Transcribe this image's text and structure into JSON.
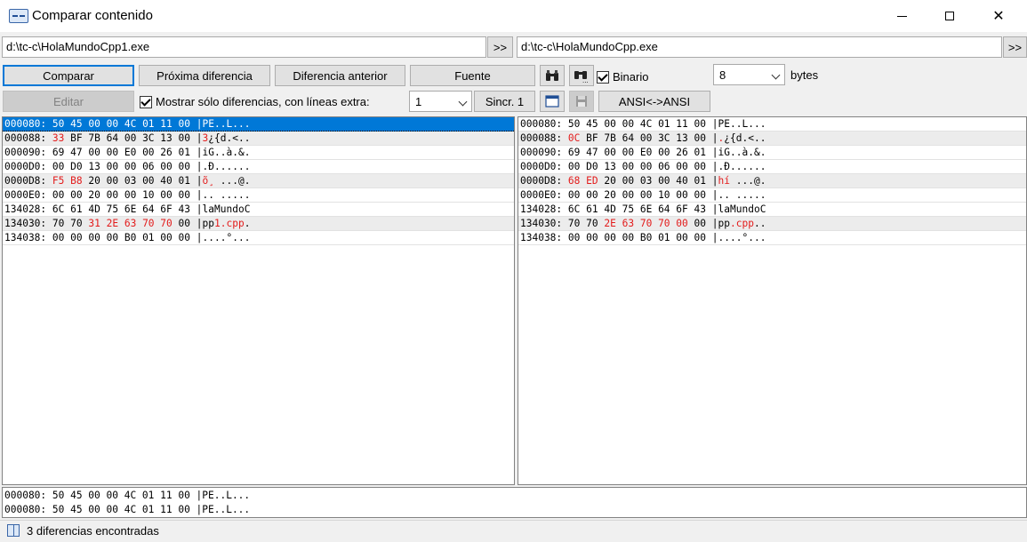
{
  "window": {
    "title": "Comparar contenido",
    "controls": {
      "minimize": "minimize",
      "maximize": "maximize",
      "close": "✕"
    }
  },
  "files": {
    "left_path": "d:\\tc-c\\HolaMundoCpp1.exe",
    "right_path": "d:\\tc-c\\HolaMundoCpp.exe",
    "browse_label": ">>"
  },
  "toolbar": {
    "compare": "Comparar",
    "next_diff": "Próxima diferencia",
    "prev_diff": "Diferencia anterior",
    "font": "Fuente",
    "find_icon": "binoculars-icon",
    "find_next_icon": "binoculars-next-icon",
    "binary_label": "Binario",
    "binary_checked": true,
    "bytes_value": "8",
    "bytes_label": "bytes",
    "edit": "Editar",
    "show_diff_only_label": "Mostrar sólo diferencias, con líneas extra:",
    "show_diff_only_checked": true,
    "extra_lines_value": "1",
    "sync": "Sincr. 1",
    "save_icon": "save-icon",
    "window_icon": "window-icon",
    "ansi": "ANSI<->ANSI"
  },
  "left_lines": [
    {
      "addr": "000080:",
      "bytes": [
        "50",
        "45",
        "00",
        "00",
        "4C",
        "01",
        "11",
        "00"
      ],
      "ascii": "PE..L...",
      "diff_bytes": [],
      "selected": true
    },
    {
      "addr": "000088:",
      "bytes": [
        "33",
        "BF",
        "7B",
        "64",
        "00",
        "3C",
        "13",
        "00"
      ],
      "ascii": "3¿{d.<..",
      "diff_bytes": [
        0
      ],
      "diff_ascii": [
        0
      ],
      "diffrow": true
    },
    {
      "addr": "000090:",
      "bytes": [
        "69",
        "47",
        "00",
        "00",
        "E0",
        "00",
        "26",
        "01"
      ],
      "ascii": "iG..à.&.",
      "diff_bytes": []
    },
    {
      "addr": "0000D0:",
      "bytes": [
        "00",
        "D0",
        "13",
        "00",
        "00",
        "06",
        "00",
        "00"
      ],
      "ascii": ".Ð......",
      "diff_bytes": []
    },
    {
      "addr": "0000D8:",
      "bytes": [
        "F5",
        "B8",
        "20",
        "00",
        "03",
        "00",
        "40",
        "01"
      ],
      "ascii": "õ¸ ...@.",
      "diff_bytes": [
        0,
        1
      ],
      "diff_ascii": [
        0,
        1
      ],
      "diffrow": true
    },
    {
      "addr": "0000E0:",
      "bytes": [
        "00",
        "00",
        "20",
        "00",
        "00",
        "10",
        "00",
        "00"
      ],
      "ascii": ".. .....",
      "diff_bytes": []
    },
    {
      "addr": "134028:",
      "bytes": [
        "6C",
        "61",
        "4D",
        "75",
        "6E",
        "64",
        "6F",
        "43"
      ],
      "ascii": "laMundoC",
      "diff_bytes": []
    },
    {
      "addr": "134030:",
      "bytes": [
        "70",
        "70",
        "31",
        "2E",
        "63",
        "70",
        "70",
        "00"
      ],
      "ascii": "pp1.cpp.",
      "diff_bytes": [
        2,
        3,
        4,
        5,
        6
      ],
      "diff_ascii": [
        2,
        3,
        4,
        5,
        6
      ],
      "diffrow": true
    },
    {
      "addr": "134038:",
      "bytes": [
        "00",
        "00",
        "00",
        "00",
        "B0",
        "01",
        "00",
        "00"
      ],
      "ascii": "....°...",
      "diff_bytes": []
    }
  ],
  "right_lines": [
    {
      "addr": "000080:",
      "bytes": [
        "50",
        "45",
        "00",
        "00",
        "4C",
        "01",
        "11",
        "00"
      ],
      "ascii": "PE..L...",
      "diff_bytes": []
    },
    {
      "addr": "000088:",
      "bytes": [
        "0C",
        "BF",
        "7B",
        "64",
        "00",
        "3C",
        "13",
        "00"
      ],
      "ascii": ".¿{d.<..",
      "diff_bytes": [
        0
      ],
      "diff_ascii": [
        0
      ],
      "diffrow": true
    },
    {
      "addr": "000090:",
      "bytes": [
        "69",
        "47",
        "00",
        "00",
        "E0",
        "00",
        "26",
        "01"
      ],
      "ascii": "iG..à.&.",
      "diff_bytes": []
    },
    {
      "addr": "0000D0:",
      "bytes": [
        "00",
        "D0",
        "13",
        "00",
        "00",
        "06",
        "00",
        "00"
      ],
      "ascii": ".Ð......",
      "diff_bytes": []
    },
    {
      "addr": "0000D8:",
      "bytes": [
        "68",
        "ED",
        "20",
        "00",
        "03",
        "00",
        "40",
        "01"
      ],
      "ascii": "hí ...@.",
      "diff_bytes": [
        0,
        1
      ],
      "diff_ascii": [
        0,
        1
      ],
      "diffrow": true
    },
    {
      "addr": "0000E0:",
      "bytes": [
        "00",
        "00",
        "20",
        "00",
        "00",
        "10",
        "00",
        "00"
      ],
      "ascii": ".. .....",
      "diff_bytes": []
    },
    {
      "addr": "134028:",
      "bytes": [
        "6C",
        "61",
        "4D",
        "75",
        "6E",
        "64",
        "6F",
        "43"
      ],
      "ascii": "laMundoC",
      "diff_bytes": []
    },
    {
      "addr": "134030:",
      "bytes": [
        "70",
        "70",
        "2E",
        "63",
        "70",
        "70",
        "00",
        "00"
      ],
      "ascii": "pp.cpp..",
      "diff_bytes": [
        2,
        3,
        4,
        5,
        6
      ],
      "diff_ascii": [
        2,
        3,
        4,
        5
      ],
      "diffrow": true
    },
    {
      "addr": "134038:",
      "bytes": [
        "00",
        "00",
        "00",
        "00",
        "B0",
        "01",
        "00",
        "00"
      ],
      "ascii": "....°...",
      "diff_bytes": []
    }
  ],
  "bottom_lines": [
    "000080: 50 45 00 00 4C 01 11 00 |PE..L...",
    "000080: 50 45 00 00 4C 01 11 00 |PE..L..."
  ],
  "status": {
    "icon": "panes-icon",
    "text": "3 diferencias encontradas"
  },
  "colors": {
    "diff": "#e31b1b",
    "selection": "#0078d7",
    "accent_border": "#0078d7"
  }
}
